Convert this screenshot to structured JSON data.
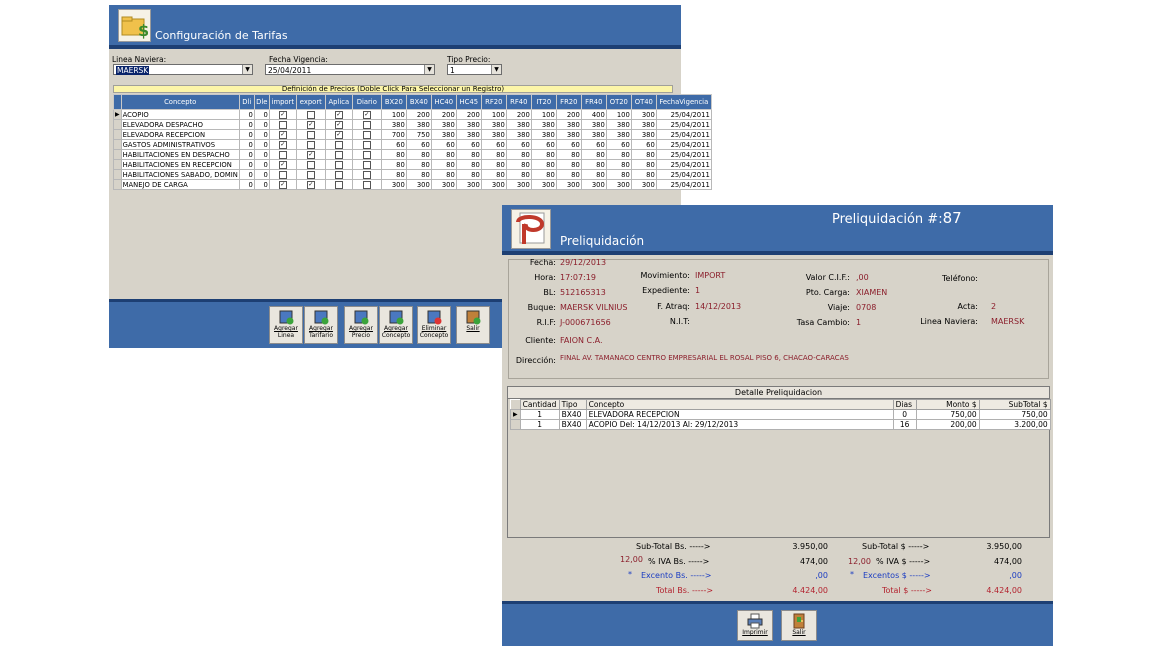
{
  "tarifas": {
    "title": "Configuración de Tarifas",
    "linea_label": "Linea Naviera:",
    "linea_value": "MAERSK",
    "fecha_label": "Fecha Vigencia:",
    "fecha_value": "25/04/2011",
    "tipo_label": "Tipo Precio:",
    "tipo_value": "1",
    "grid_title": "Definición de Precios (Doble Click Para Seleccionar un Registro)",
    "columns": [
      "Concepto",
      "Dli",
      "Dle",
      "import",
      "export",
      "Aplica",
      "Diario",
      "BX20",
      "BX40",
      "HC40",
      "HC45",
      "RF20",
      "RF40",
      "IT20",
      "FR20",
      "FR40",
      "OT20",
      "OT40",
      "FechaVigencia"
    ],
    "rows": [
      {
        "concepto": "ACOPIO",
        "dli": "0",
        "dle": "0",
        "import": true,
        "export": false,
        "aplica": true,
        "diario": true,
        "bx20": "100",
        "bx40": "200",
        "hc40": "200",
        "hc45": "200",
        "rf20": "100",
        "rf40": "200",
        "it20": "100",
        "fr20": "200",
        "fr40": "400",
        "ot20": "100",
        "ot40": "300",
        "fecha": "25/04/2011"
      },
      {
        "concepto": "ELEVADORA DESPACHO",
        "dli": "0",
        "dle": "0",
        "import": false,
        "export": true,
        "aplica": true,
        "diario": false,
        "bx20": "380",
        "bx40": "380",
        "hc40": "380",
        "hc45": "380",
        "rf20": "380",
        "rf40": "380",
        "it20": "380",
        "fr20": "380",
        "fr40": "380",
        "ot20": "380",
        "ot40": "380",
        "fecha": "25/04/2011"
      },
      {
        "concepto": "ELEVADORA RECEPCION",
        "dli": "0",
        "dle": "0",
        "import": true,
        "export": false,
        "aplica": true,
        "diario": false,
        "bx20": "700",
        "bx40": "750",
        "hc40": "380",
        "hc45": "380",
        "rf20": "380",
        "rf40": "380",
        "it20": "380",
        "fr20": "380",
        "fr40": "380",
        "ot20": "380",
        "ot40": "380",
        "fecha": "25/04/2011"
      },
      {
        "concepto": "GASTOS ADMINISTRATIVOS",
        "dli": "0",
        "dle": "0",
        "import": true,
        "export": false,
        "aplica": false,
        "diario": false,
        "bx20": "60",
        "bx40": "60",
        "hc40": "60",
        "hc45": "60",
        "rf20": "60",
        "rf40": "60",
        "it20": "60",
        "fr20": "60",
        "fr40": "60",
        "ot20": "60",
        "ot40": "60",
        "fecha": "25/04/2011"
      },
      {
        "concepto": "HABILITACIONES EN DESPACHO",
        "dli": "0",
        "dle": "0",
        "import": false,
        "export": true,
        "aplica": false,
        "diario": false,
        "bx20": "80",
        "bx40": "80",
        "hc40": "80",
        "hc45": "80",
        "rf20": "80",
        "rf40": "80",
        "it20": "80",
        "fr20": "80",
        "fr40": "80",
        "ot20": "80",
        "ot40": "80",
        "fecha": "25/04/2011"
      },
      {
        "concepto": "HABILITACIONES EN RECEPCION",
        "dli": "0",
        "dle": "0",
        "import": true,
        "export": false,
        "aplica": false,
        "diario": false,
        "bx20": "80",
        "bx40": "80",
        "hc40": "80",
        "hc45": "80",
        "rf20": "80",
        "rf40": "80",
        "it20": "80",
        "fr20": "80",
        "fr40": "80",
        "ot20": "80",
        "ot40": "80",
        "fecha": "25/04/2011"
      },
      {
        "concepto": "HABILITACIONES SABADO, DOMIN",
        "dli": "0",
        "dle": "0",
        "import": false,
        "export": false,
        "aplica": false,
        "diario": false,
        "bx20": "80",
        "bx40": "80",
        "hc40": "80",
        "hc45": "80",
        "rf20": "80",
        "rf40": "80",
        "it20": "80",
        "fr20": "80",
        "fr40": "80",
        "ot20": "80",
        "ot40": "80",
        "fecha": "25/04/2011"
      },
      {
        "concepto": "MANEJO DE CARGA",
        "dli": "0",
        "dle": "0",
        "import": true,
        "export": true,
        "aplica": false,
        "diario": false,
        "bx20": "300",
        "bx40": "300",
        "hc40": "300",
        "hc45": "300",
        "rf20": "300",
        "rf40": "300",
        "it20": "300",
        "fr20": "300",
        "fr40": "300",
        "ot20": "300",
        "ot40": "300",
        "fecha": "25/04/2011"
      }
    ],
    "buttons": [
      {
        "line1": "Agregar",
        "line2": "Linea",
        "icon": "add-line-icon"
      },
      {
        "line1": "Agregar",
        "line2": "Tarifario",
        "icon": "add-tariff-icon"
      },
      {
        "line1": "Agregar",
        "line2": "Precio",
        "icon": "add-price-icon"
      },
      {
        "line1": "Agregar",
        "line2": "Concepto",
        "icon": "add-concept-icon"
      },
      {
        "line1": "Eliminar",
        "line2": "Concepto",
        "icon": "delete-concept-icon"
      },
      {
        "line1": "Salir",
        "line2": "",
        "icon": "exit-door-icon"
      }
    ]
  },
  "preliq": {
    "title": "Preliquidación",
    "number_label": "Preliquidación  #:",
    "number_value": "87",
    "fields": {
      "fecha": {
        "label": "Fecha:",
        "value": "29/12/2013"
      },
      "hora": {
        "label": "Hora:",
        "value": "17:07:19"
      },
      "bl": {
        "label": "BL:",
        "value": "512165313"
      },
      "buque": {
        "label": "Buque:",
        "value": "MAERSK VILNIUS"
      },
      "rif": {
        "label": "R.I.F:",
        "value": "J-000671656"
      },
      "cliente": {
        "label": "Cliente:",
        "value": "FAION C.A."
      },
      "direccion": {
        "label": "Dirección:",
        "value": "FINAL AV. TAMANACO CENTRO EMPRESARIAL EL ROSAL PISO 6, CHACAO-CARACAS"
      },
      "movimiento": {
        "label": "Movimiento:",
        "value": "IMPORT"
      },
      "expediente": {
        "label": "Expediente:",
        "value": "1"
      },
      "fatraq": {
        "label": "F. Atraq:",
        "value": "14/12/2013"
      },
      "nit": {
        "label": "N.I.T:",
        "value": ""
      },
      "cif": {
        "label": "Valor C.I.F.:",
        "value": ",00"
      },
      "ptocarga": {
        "label": "Pto. Carga:",
        "value": "XIAMEN"
      },
      "viaje": {
        "label": "Viaje:",
        "value": "0708"
      },
      "tasa": {
        "label": "Tasa Cambio:",
        "value": "1"
      },
      "telefono": {
        "label": "Teléfono:",
        "value": ""
      },
      "acta": {
        "label": "Acta:",
        "value": "2"
      },
      "linea": {
        "label": "Linea Naviera:",
        "value": "MAERSK"
      }
    },
    "detail_title": "Detalle Preliquidacion",
    "detail_columns": [
      "Cantidad",
      "Tipo",
      "Concepto",
      "Dias",
      "Monto $",
      "SubTotal $"
    ],
    "detail_rows": [
      {
        "cantidad": "1",
        "tipo": "BX40",
        "concepto": "ELEVADORA RECEPCION",
        "dias": "0",
        "monto": "750,00",
        "subtotal": "750,00"
      },
      {
        "cantidad": "1",
        "tipo": "BX40",
        "concepto": "ACOPIO Del: 14/12/2013 Al: 29/12/2013",
        "dias": "16",
        "monto": "200,00",
        "subtotal": "3.200,00"
      }
    ],
    "totals": {
      "subtotal_bs_label": "Sub-Total Bs. ----->",
      "subtotal_bs": "3.950,00",
      "iva_pct_bs": "12,00",
      "iva_bs_label": "% IVA Bs. ----->",
      "iva_bs": "474,00",
      "exento_bs_star": "*",
      "exento_bs_label": "Excento Bs. ----->",
      "exento_bs": ",00",
      "total_bs_label": "Total Bs. ----->",
      "total_bs": "4.424,00",
      "subtotal_usd_label": "Sub-Total $ ----->",
      "subtotal_usd": "3.950,00",
      "iva_pct_usd": "12,00",
      "iva_usd_label": "% IVA $ ----->",
      "iva_usd": "474,00",
      "exento_usd_star": "*",
      "exento_usd_label": "Excentos $ ----->",
      "exento_usd": ",00",
      "total_usd_label": "Total $ ----->",
      "total_usd": "4.424,00"
    },
    "buttons": [
      {
        "label": "Imprimir",
        "icon": "printer-icon"
      },
      {
        "label": "Salir",
        "icon": "exit-door-icon"
      }
    ]
  }
}
